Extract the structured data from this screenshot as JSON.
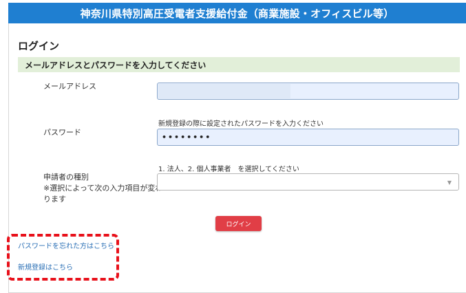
{
  "header": {
    "title": "神奈川県特別高圧受電者支援給付金（商業施設・オフィスビル等）"
  },
  "login": {
    "title": "ログイン"
  },
  "instruction": {
    "text": "メールアドレスとパスワードを入力してください"
  },
  "form": {
    "email": {
      "label": "メールアドレス",
      "value": ""
    },
    "password": {
      "label": "パスワード",
      "hint": "新規登録の際に設定されたパスワードを入力ください",
      "value": "••••••••"
    },
    "applicant_type": {
      "label_line1": "申請者の種別",
      "label_line2": "※選択によって次の入力項目が変わ",
      "label_line3": "ります",
      "hint": "1. 法人、2. 個人事業者　を選択してください",
      "selected": ""
    }
  },
  "buttons": {
    "login": "ログイン"
  },
  "links": {
    "forgot_password": "パスワードを忘れた方はこちら",
    "register": "新規登録はこちら"
  },
  "colors": {
    "header_bg": "#1f7fd1",
    "instruction_bg": "#e2efd9",
    "button_bg": "#e13e46",
    "annotation": "#e8101a",
    "link": "#2a6fb5"
  }
}
